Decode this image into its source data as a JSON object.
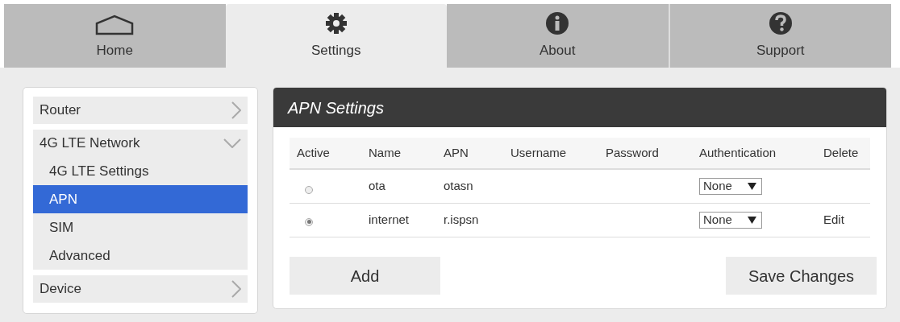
{
  "tabs": [
    {
      "label": "Home",
      "selected": false
    },
    {
      "label": "Settings",
      "selected": true
    },
    {
      "label": "About",
      "selected": false
    },
    {
      "label": "Support",
      "selected": false
    }
  ],
  "sidebar": {
    "items": [
      {
        "label": "Router",
        "expanded": false
      },
      {
        "label": "4G LTE Network",
        "expanded": true,
        "children": [
          {
            "label": "4G LTE Settings",
            "selected": false
          },
          {
            "label": "APN",
            "selected": true
          },
          {
            "label": "SIM",
            "selected": false
          },
          {
            "label": "Advanced",
            "selected": false
          }
        ]
      },
      {
        "label": "Device",
        "expanded": false
      }
    ]
  },
  "panel": {
    "title": "APN Settings",
    "table": {
      "columns": [
        "Active",
        "Name",
        "APN",
        "Username",
        "Password",
        "Authentication",
        "Delete"
      ],
      "rows": [
        {
          "selected": false,
          "name": "ota",
          "apn": "otasn",
          "authentication": "None"
        },
        {
          "selected": true,
          "name": "internet",
          "apn": "r.ispsn",
          "authentication": "None",
          "action": "Edit"
        }
      ]
    },
    "buttons": [
      "Add",
      "Save Changes"
    ]
  }
}
